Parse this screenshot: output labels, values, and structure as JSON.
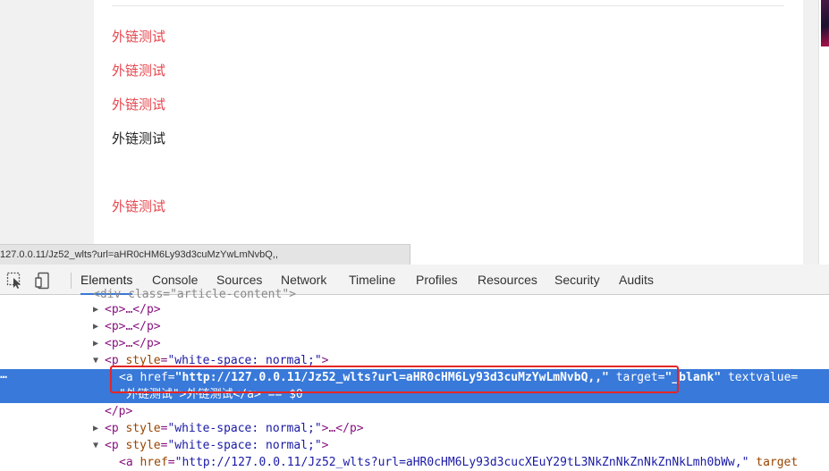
{
  "page": {
    "links": [
      {
        "text": "外链测试",
        "color": "#e8454d"
      },
      {
        "text": "外链测试",
        "color": "#e8454d"
      },
      {
        "text": "外链测试",
        "color": "#e8454d"
      },
      {
        "text": "外链测试",
        "color": "#222222"
      },
      {
        "text": "外链测试",
        "color": "#e8454d"
      }
    ],
    "status_url": "127.0.0.11/Jz52_wlts?url=aHR0cHM6Ly93d3cuMzYwLmNvbQ,,"
  },
  "devtools": {
    "tabs": [
      "Elements",
      "Console",
      "Sources",
      "Network",
      "Timeline",
      "Profiles",
      "Resources",
      "Security",
      "Audits"
    ],
    "active_tab": "Elements",
    "icons": [
      "inspect-cursor-icon",
      "device-mode-icon"
    ],
    "dom": {
      "row0": "<div class=\"article-content\">",
      "row1": "<p>…</p>",
      "row2": "<p>…</p>",
      "row3": "<p>…</p>",
      "row4_tag_open": "<p ",
      "row4_attr": "style",
      "row4_val": "\"white-space: normal;\"",
      "row4_close": ">",
      "sel_tag": "<a ",
      "sel_href_attr": "href",
      "sel_href_val": "\"http://127.0.0.11/Jz52_wlts?url=aHR0cHM6Ly93d3cuMzYwLmNvbQ,,\"",
      "sel_target_attr": "target",
      "sel_target_val": "\"_blank\"",
      "sel_textvalue_attr": "textvalue",
      "sel_eq": "=",
      "sel_line2": "\"外链测试\">外链测试</a> == $0",
      "row7": "</p>",
      "row8_open": "<p ",
      "row8_attr": "style",
      "row8_val": "\"white-space: normal;\"",
      "row8_close": ">…</p>",
      "row9_open": "<p ",
      "row9_attr": "style",
      "row9_val": "\"white-space: normal;\"",
      "row9_close": ">",
      "row10_tag": "<a ",
      "row10_href_attr": "href",
      "row10_href_val": "\"http://127.0.0.11/Jz52_wlts?url=aHR0cHM6Ly93d3cucXEuY29tL3NkZnNkZnNkZnNkLmh0bWw,\"",
      "row10_target": "target",
      "selected_marker": "⋯"
    }
  },
  "colors": {
    "link_red": "#e8454d",
    "selection_blue": "#3879d9",
    "highlight_red": "#e52525"
  }
}
